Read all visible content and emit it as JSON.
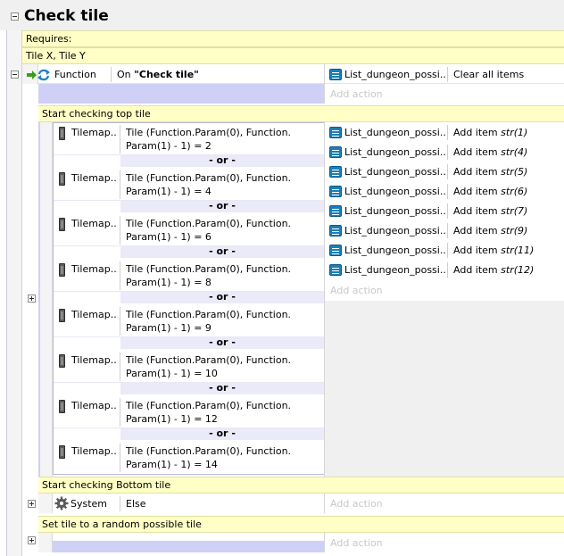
{
  "group": {
    "title": "Check tile",
    "requires_label": "Requires:",
    "params": "Tile X, Tile Y"
  },
  "event1": {
    "object": "Function",
    "condition_prefix": "On ",
    "condition_name": "\"Check tile\"",
    "action_object": "List_dungeon_possi...",
    "action_text": "Clear all items",
    "add_action": "Add action"
  },
  "comments": {
    "top": "Start checking top tile",
    "bottom": "Start checking Bottom tile",
    "random": "Set tile to a random possible tile"
  },
  "event2": {
    "or_label": "- or -",
    "conditions": [
      {
        "object": "Tilemap...",
        "line1": "Tile (Function.Param(0), Function.",
        "line2": "Param(1) - 1) = 2"
      },
      {
        "object": "Tilemap...",
        "line1": "Tile (Function.Param(0), Function.",
        "line2": "Param(1) - 1) = 4"
      },
      {
        "object": "Tilemap...",
        "line1": "Tile (Function.Param(0), Function.",
        "line2": "Param(1) - 1) = 6"
      },
      {
        "object": "Tilemap...",
        "line1": "Tile (Function.Param(0), Function.",
        "line2": "Param(1) - 1) = 8"
      },
      {
        "object": "Tilemap...",
        "line1": "Tile (Function.Param(0), Function.",
        "line2": "Param(1) - 1) = 9"
      },
      {
        "object": "Tilemap...",
        "line1": "Tile (Function.Param(0), Function.",
        "line2": "Param(1) - 1) = 10"
      },
      {
        "object": "Tilemap...",
        "line1": "Tile (Function.Param(0), Function.",
        "line2": "Param(1) - 1) = 12"
      },
      {
        "object": "Tilemap...",
        "line1": "Tile (Function.Param(0), Function.",
        "line2": "Param(1) - 1) = 14"
      }
    ],
    "actions": [
      {
        "object": "List_dungeon_possi...",
        "verb": "Add item ",
        "arg": "str(1)"
      },
      {
        "object": "List_dungeon_possi...",
        "verb": "Add item ",
        "arg": "str(4)"
      },
      {
        "object": "List_dungeon_possi...",
        "verb": "Add item ",
        "arg": "str(5)"
      },
      {
        "object": "List_dungeon_possi...",
        "verb": "Add item ",
        "arg": "str(6)"
      },
      {
        "object": "List_dungeon_possi...",
        "verb": "Add item ",
        "arg": "str(7)"
      },
      {
        "object": "List_dungeon_possi...",
        "verb": "Add item ",
        "arg": "str(9)"
      },
      {
        "object": "List_dungeon_possi...",
        "verb": "Add item ",
        "arg": "str(11)"
      },
      {
        "object": "List_dungeon_possi...",
        "verb": "Add item ",
        "arg": "str(12)"
      }
    ],
    "add_action": "Add action"
  },
  "event3": {
    "object": "System",
    "condition": "Else",
    "add_action": "Add action"
  },
  "event4": {
    "add_action": "Add action"
  },
  "colors": {
    "comment_bg": "#ffffc6",
    "tree_blue": "#cfd0f5",
    "list_icon": "#1c7eb8",
    "placeholder_gray": "#c8c8c8"
  },
  "icons": [
    "collapse-icon",
    "expand-icon",
    "function-icon",
    "list-icon",
    "tilemap-icon",
    "gear-icon"
  ]
}
